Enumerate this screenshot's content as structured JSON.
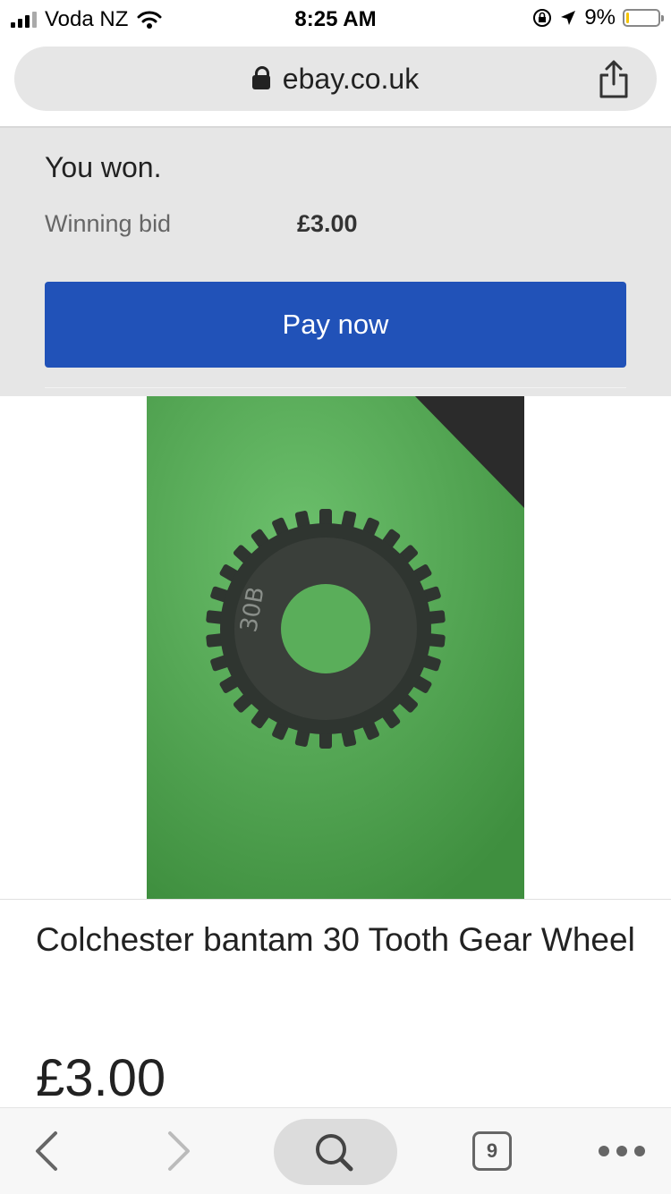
{
  "status_bar": {
    "carrier": "Voda NZ",
    "time": "8:25 AM",
    "battery": "9%",
    "battery_level": 0.09
  },
  "browser": {
    "url": "ebay.co.uk",
    "tab_count": "9"
  },
  "won_panel": {
    "title": "You won.",
    "winning_bid_label": "Winning bid",
    "winning_bid_value": "£3.00",
    "pay_button": "Pay now"
  },
  "item": {
    "gear_marking": "30B",
    "title": "Colchester bantam 30 Tooth Gear Wheel",
    "price": "£3.00"
  },
  "colors": {
    "pay_button": "#2152b8",
    "panel_bg": "#e6e6e6",
    "photo_bg": "#5cb05c"
  },
  "icons": [
    "signal-icon",
    "wifi-icon",
    "orientation-lock-icon",
    "location-icon",
    "battery-icon",
    "lock-icon",
    "share-icon",
    "back-icon",
    "forward-icon",
    "search-icon",
    "tabs-icon",
    "more-icon"
  ]
}
